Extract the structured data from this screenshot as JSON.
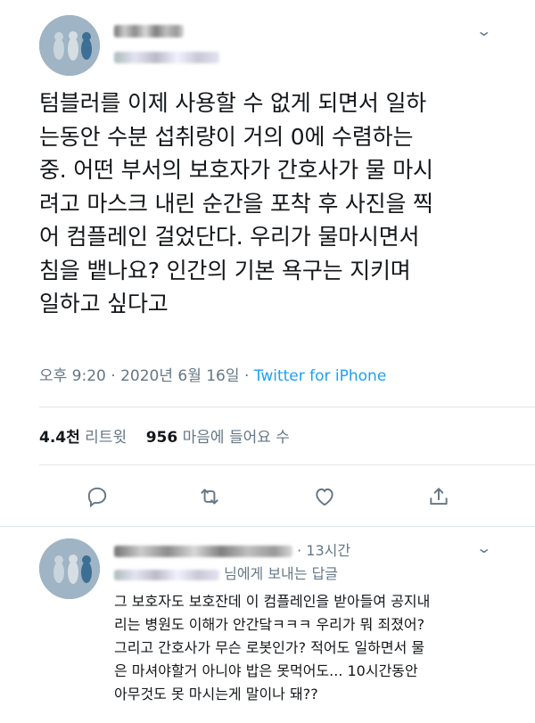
{
  "tweet": {
    "text": "텀블러를 이제 사용할 수 없게 되면서 일하\n는동안 수분 섭취량이 거의 0에 수렴하는\n중. 어떤 부서의 보호자가 간호사가 물 마시\n려고 마스크 내린 순간을 포착 후 사진을 찍\n어 컴플레인 걸었단다. 우리가 물마시면서\n침을 뱉나요? 인간의 기본 욕구는 지키며\n일하고 싶다고",
    "time": "오후 9:20",
    "date": "2020년 6월 16일",
    "source": "Twitter for iPhone",
    "separator": "·",
    "retweet_count": "4.4천",
    "retweet_label": "리트윗",
    "like_count": "956",
    "like_label": "마음에 들어요 수"
  },
  "actions": [
    "reply-icon",
    "retweet-icon",
    "like-icon",
    "share-icon"
  ],
  "reply": {
    "time": "13시간",
    "separator": "·",
    "replying_to_suffix": "님에게 보내는 답글",
    "text": "그 보호자도 보호잔데 이 컴플레인을 받아들여 공지내\n리는 병원도 이해가 안간닼ㅋㅋㅋ 우리가 뭐 죄졌어?\n그리고 간호사가 무슨 로봇인가? 적어도 일하면서 물\n은 마셔야할거 아니야 밥은 못먹어도... 10시간동안\n아무것도 못 마시는게 말이나 돼??"
  },
  "colors": {
    "text": "#14171a",
    "secondary": "#657786",
    "link": "#1da1f2",
    "divider": "#e1e8ed"
  }
}
